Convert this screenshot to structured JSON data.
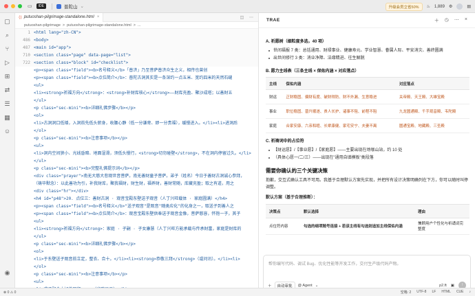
{
  "titlebar": {
    "ide_badge": "IDE",
    "project": "普陀山",
    "upgrade": "升级会员立省50%",
    "count": "1,889"
  },
  "editor": {
    "tab": "putuoshan-pilgrimage-standalone.html",
    "breadcrumbs": [
      "putuoshan-pilgrimage",
      ">",
      "putuoshan-pilgrimage-standalone.html",
      ">",
      "..."
    ],
    "lines": [
      {
        "n": "1",
        "t": "<html lang=\"zh-CN\">"
      },
      {
        "n": "486",
        "t": "<body>"
      },
      {
        "n": "487",
        "t": "<main id=\"app\">"
      },
      {
        "n": "710",
        "t": "  <section class=\"page\" data-page=\"list\">"
      },
      {
        "n": "722",
        "t": "    <section class=\"block\" id=\"checklist\">"
      },
      {
        "n": "",
        "t": "<p><span class=\"field\"><b>名号释义</b>「普济」乃至菩萨普济众生之义，相传也曾创"
      },
      {
        "n": "",
        "t": "<p><span class=\"field\"><b>点位简介</b>：普陀古洞其实是一条深约一点五米、宽约四米的天然石缝"
      },
      {
        "n": "",
        "t": "<ul>"
      },
      {
        "n": "",
        "t": "<li><strong>祈福方向</strong>：<strong>补财库核心</strong>——财库充盈、聚沙成塔；以善财五"
      },
      {
        "n": "",
        "t": "</ul>"
      },
      {
        "n": "",
        "t": "<p class=\"sec-mini\"><b>详细礼佛步骤</b></p>"
      },
      {
        "n": "",
        "t": "<ol>"
      },
      {
        "n": "",
        "t": "<li>古洞洞口低矮，入洞前先低头俯身，收腰心静（低一分谦卑、即一分贵福），缓慢进入。</li><li>进洞后"
      },
      {
        "n": "",
        "t": "</ol>"
      },
      {
        "n": "",
        "t": "<p class=\"sec-mini\"><b>注意事项</b></p>"
      },
      {
        "n": "",
        "t": "<ul>"
      },
      {
        "n": "",
        "t": "<li>洞内空间狭小、光线昏暗、地面湿滑，须低头慢行，<strong>切勿碰壁</strong>，不在洞内停留过久。</li>"
      },
      {
        "n": "",
        "t": "</ul>"
      },
      {
        "n": "",
        "t": "<p class=\"sec-mini\"><b>完整礼佛提示词</b></p>"
      },
      {
        "n": "",
        "t": "<div class=\"prayer\">南无大慈大悲观世音菩萨。南无善财童子菩萨。弟子（姓名）今日于善财古洞诚心参拜，"
      },
      {
        "n": "",
        "t": "（祷毕默念）：以此善功为引，补我财库，聚我福财，财生财，福养财，善财常随，库藏充盈；取之有道，用之"
      },
      {
        "n": "",
        "t": "<div class=\"hr\"></div>"
      },
      {
        "n": "",
        "t": "<h4 id=\"p48\">20. 点位三：善财古洞 · 观音宝殿东壁送子观音（人丁兴旺载体 · 家庭圆满）</h4>"
      },
      {
        "n": "",
        "t": "<p><span class=\"field\"><b>名号释义</b>\"送子观音\"是观音\"随类应化\"的化身之一，取送子到善人之"
      },
      {
        "n": "",
        "t": "<p><span class=\"field\"><b>点位简介</b>：观音宝殿东壁供奉送子观音金像，菩萨慈容，怀抱一子，其子"
      },
      {
        "n": "",
        "t": "<ul>"
      },
      {
        "n": "",
        "t": "<li><strong>祈福方向</strong>：家庭 · 子嗣 · 子女康慧（人丁兴旺方能承载与传承财富，家庭是财库的"
      },
      {
        "n": "",
        "t": "</ul>"
      },
      {
        "n": "",
        "t": "<p class=\"sec-mini\"><b>详细礼佛步骤</b></p>"
      },
      {
        "n": "",
        "t": "<ol>"
      },
      {
        "n": "",
        "t": "<li>于东壁送子观音前立定，整衣、合十。</li><li><strong>恭敬三拜</strong>（或问讯）。</li><li>"
      },
      {
        "n": "",
        "t": "</ol>"
      },
      {
        "n": "",
        "t": "<p class=\"sec-mini\"><b>注意事项</b></p>"
      },
      {
        "n": "",
        "t": "<ul>"
      },
      {
        "n": "",
        "t": "<li>求子配合大好善四拜，...（省略显示）</li>"
      }
    ]
  },
  "chat": {
    "title": "TRAE",
    "sectionA": {
      "title": "A. 祈愿树（细粒度多选，40 项）",
      "items": [
        "世间福报 7 类：总括通用、财禄事业、健康寿元、学业智慧、眷属人际、平安消灾、善终圆满",
        "出世间修行 3 类：消业净障、法缘精进、往生解脱"
      ]
    },
    "sectionB": {
      "title": "B. 愿力主线表（三条主线 × 保佑内涵 × 对应落点）",
      "headers": [
        "主线",
        "保佑内涵",
        "对应落点"
      ],
      "rows": [
        [
          "财运",
          "正财稳固、偏财有度、破财得防、财不外漏、生意稳进",
          "关帝殿、天王殿、大雄宝殿"
        ],
        [
          "事业",
          "职位稳固、晋升顺遂、贵人长护、诸事不阻、前程不阻",
          "九龙圆通殿、千手观音殿、韦陀殿"
        ],
        [
          "家庭",
          "合家安康、六亲和睦、长辈康健、家宅安宁、夫妻不离",
          "圆通宝殿、地藏殿、三圣殿"
        ]
      ]
    },
    "sectionC": {
      "title": "C. 祈祷词中的占位符",
      "items": [
        "【财运愿】/【事业愿】/【家庭愿】——主要出现在场咖山站，约 10 处",
        "（具体心愿一/二/三）——出现在\"通用自填模板\"类段落"
      ]
    },
    "heading": "需要你确认的三个关键决策",
    "paragraph": "抱歉，交互式确认工具不可用。我基于合理默认方案先实现，并把所有设计决策明确列在下方，你可以随时叫停调整。",
    "defaults_title": "默认方案（基于合理推断）：",
    "decision_table": {
      "headers": [
        "决策点",
        "默认选择",
        "理由"
      ],
      "rows": [
        [
          "点位符内容",
          "勾选的细项随号连接 + 若该主线有勾选则追加主线保佑内涵",
          "兼顾用户个性化与祈诵词完整度"
        ]
      ]
    },
    "input": {
      "placeholder": "帮你编写代码、调试 Bug、优化性能等开发工作，交付生产级代码产物。",
      "mode": "自动审批",
      "agent": "@ Agent",
      "model": "p2.ft"
    }
  },
  "statusbar": {
    "errors": "⊗ 0  ⚠ 0",
    "spaces": "空格: 2",
    "encoding": "UTF-8",
    "eol": "LF",
    "lang": "HTML",
    "brand": "CUE"
  },
  "colors": {
    "accent": "#3c6fd8",
    "code": "#1e5b9e",
    "orange": "#c0581e"
  }
}
